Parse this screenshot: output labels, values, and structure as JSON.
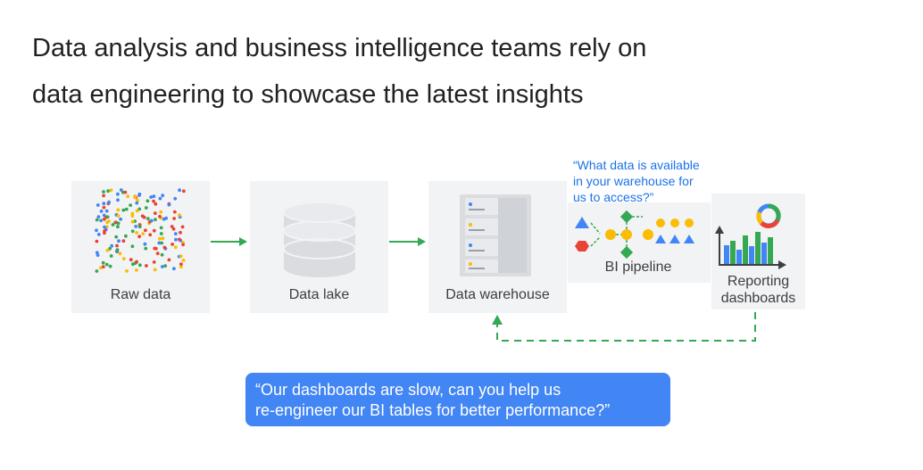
{
  "title": {
    "line1": "Data analysis and business intelligence teams rely on",
    "line2": "data engineering to showcase the latest insights"
  },
  "stages": {
    "raw": "Raw data",
    "lake": "Data lake",
    "warehouse": "Data warehouse",
    "pipeline": "BI pipeline",
    "reporting_line1": "Reporting",
    "reporting_line2": "dashboards"
  },
  "quotes": {
    "warehouse_question_line1": "“What data is available",
    "warehouse_question_line2": "in your warehouse for",
    "warehouse_question_line3": "us to access?”",
    "callout_line1": "“Our dashboards are slow, can you help us",
    "callout_line2": "re-engineer our BI tables for better performance?”"
  },
  "colors": {
    "arrow_green": "#34a853",
    "accent_blue": "#4285f4",
    "red": "#ea4335",
    "yellow": "#fbbc04",
    "panel_gray": "#f1f3f4"
  }
}
